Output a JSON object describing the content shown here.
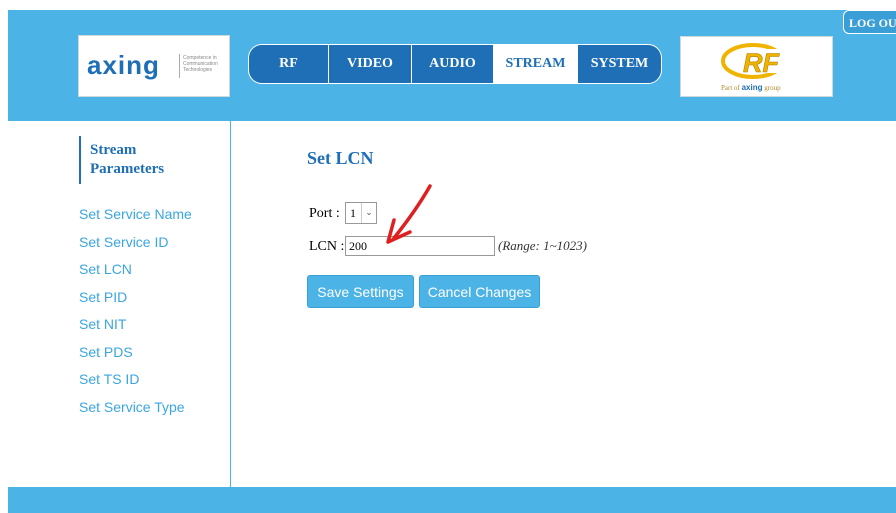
{
  "header": {
    "logout_label": "LOG OUT",
    "brand_word": "axing",
    "brand_tagline": "Competence in Communication Technologies",
    "partner_logo": "RF",
    "partner_sub_prefix": "Part of",
    "partner_sub_brand": "axing",
    "partner_sub_suffix": "group"
  },
  "nav": {
    "tabs": [
      {
        "label": "RF",
        "active": false
      },
      {
        "label": "VIDEO",
        "active": false
      },
      {
        "label": "AUDIO",
        "active": false
      },
      {
        "label": "STREAM",
        "active": true
      },
      {
        "label": "SYSTEM",
        "active": false
      }
    ]
  },
  "sidebar": {
    "heading": "Stream Parameters",
    "items": [
      {
        "label": "Set Service Name"
      },
      {
        "label": "Set Service ID"
      },
      {
        "label": "Set LCN"
      },
      {
        "label": "Set PID"
      },
      {
        "label": "Set NIT"
      },
      {
        "label": "Set PDS"
      },
      {
        "label": "Set TS ID"
      },
      {
        "label": "Set Service Type"
      }
    ]
  },
  "main": {
    "title": "Set LCN",
    "port_label": "Port :",
    "port_value": "1",
    "lcn_label": "LCN :",
    "lcn_value": "200",
    "range_text": "(Range: 1~1023)",
    "save_label": "Save Settings",
    "cancel_label": "Cancel Changes"
  },
  "icons": {
    "dropdown": "chevron-down-icon",
    "annotation": "red-arrow-annotation"
  },
  "colors": {
    "header_bg": "#4bb3e6",
    "nav_bg": "#1e6fb6",
    "link": "#3aa6e0",
    "annotation": "#e02020"
  }
}
